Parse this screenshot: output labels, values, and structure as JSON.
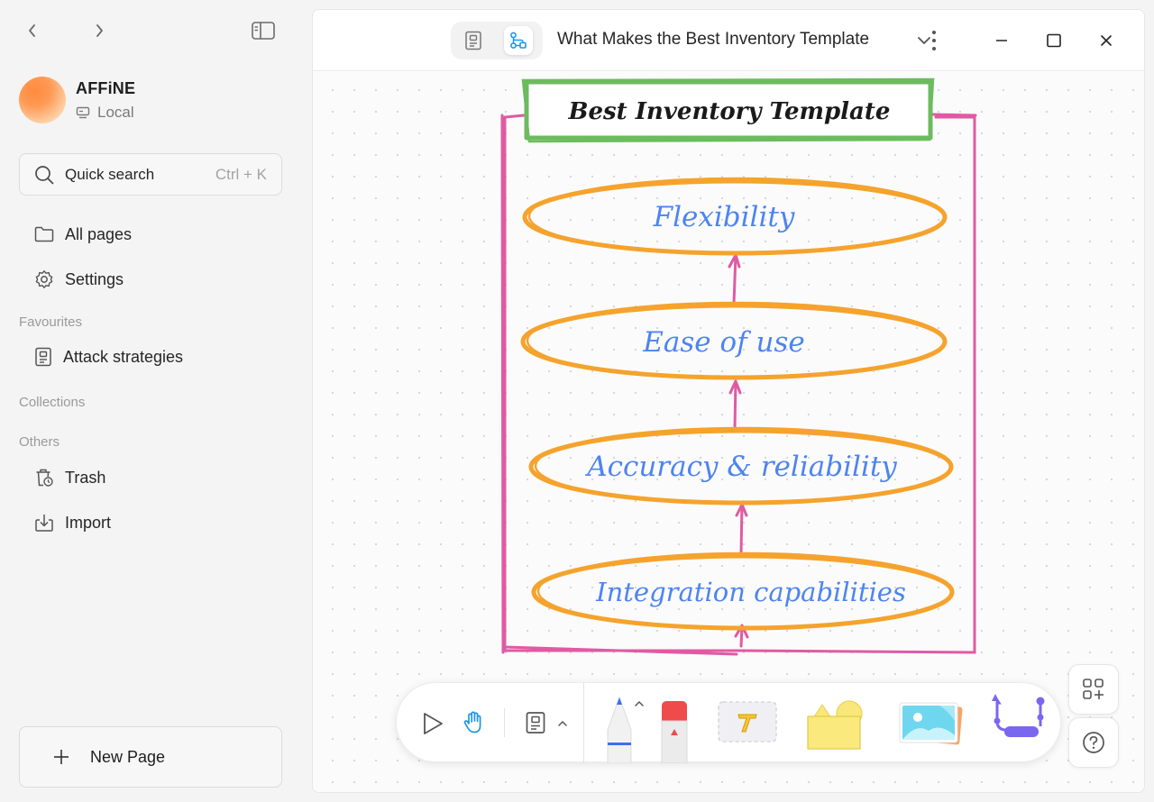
{
  "sidebar": {
    "workspace": {
      "name": "AFFiNE",
      "type": "Local"
    },
    "search": {
      "label": "Quick search",
      "shortcut": "Ctrl + K"
    },
    "items": [
      {
        "label": "All pages",
        "icon": "folder-icon"
      },
      {
        "label": "Settings",
        "icon": "gear-icon"
      }
    ],
    "favourites_title": "Favourites",
    "favourites": [
      {
        "label": "Attack strategies",
        "icon": "page-icon"
      }
    ],
    "collections_title": "Collections",
    "others_title": "Others",
    "others": [
      {
        "label": "Trash",
        "icon": "trash-icon"
      },
      {
        "label": "Import",
        "icon": "import-icon"
      }
    ],
    "new_page_label": "New Page"
  },
  "header": {
    "title": "What Makes the Best Inventory Template",
    "mode": "edgeless"
  },
  "diagram": {
    "title": "Best Inventory Template",
    "nodes": [
      "Flexibility",
      "Ease of use",
      "Accuracy & reliability",
      "Integration capabilities"
    ],
    "colors": {
      "title_border": "#6dbb5f",
      "node_border": "#f5a32d",
      "node_text": "#4d84f0",
      "connector": "#e05aa3"
    }
  },
  "toolbar": {
    "tools": [
      "select-tool",
      "hand-tool",
      "note-tool",
      "pen-tool",
      "eraser-tool",
      "text-tool",
      "shape-tool",
      "image-tool",
      "connector-tool"
    ],
    "more_label": "..."
  },
  "colors": {
    "accent": "#1e96eb"
  }
}
